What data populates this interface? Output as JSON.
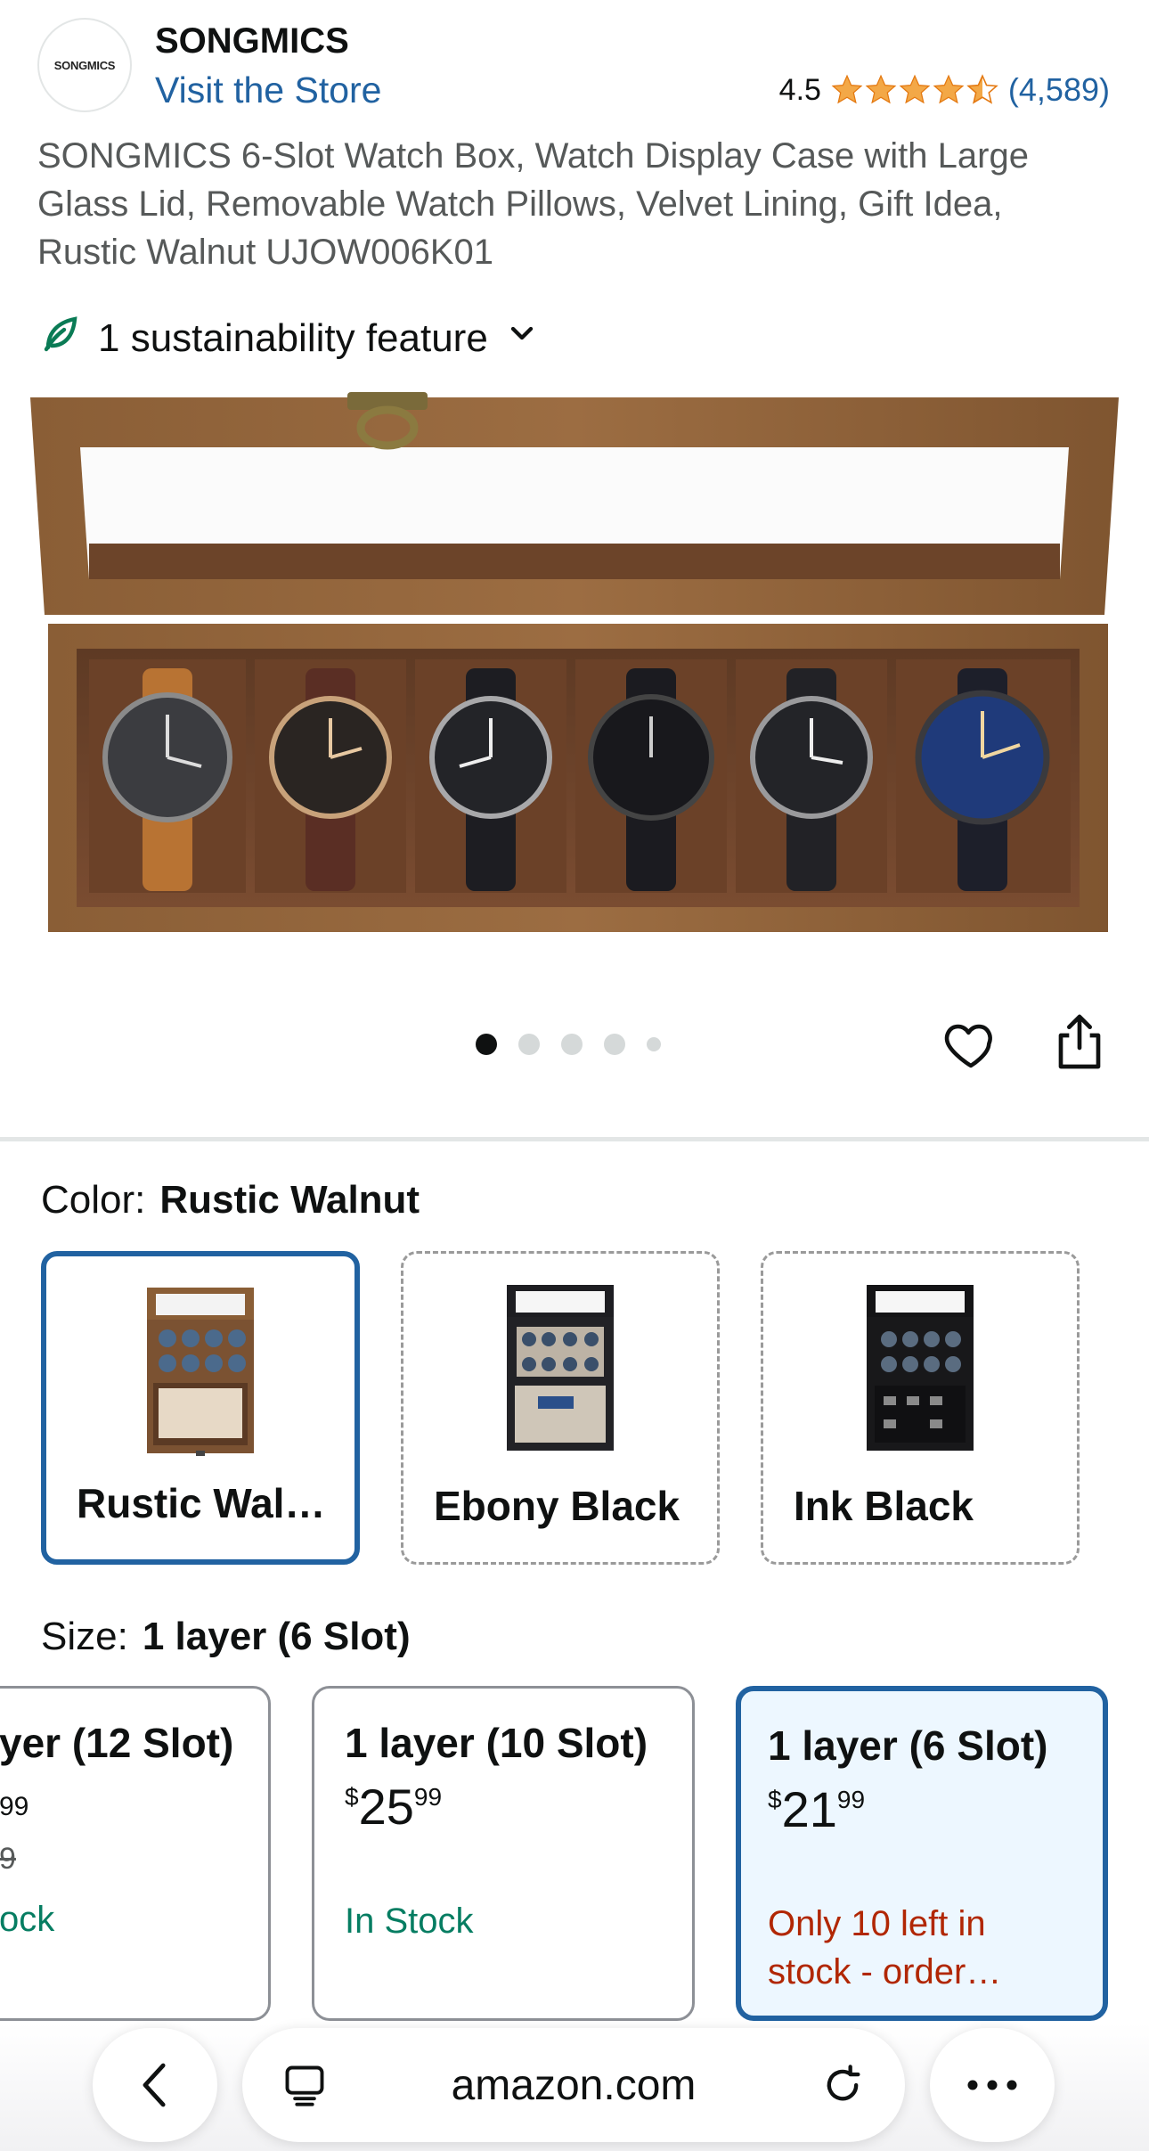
{
  "header": {
    "logo_text": "SONGMICS",
    "brand_name": "SONGMICS",
    "visit_store": "Visit the Store",
    "rating_value": "4.5",
    "rating_stars": 4.5,
    "rating_count": "(4,589)"
  },
  "product": {
    "title": "SONGMICS 6-Slot Watch Box, Watch Display Case with Large Glass Lid, Removable Watch Pillows, Velvet Lining, Gift Idea, Rustic Walnut UJOW006K01",
    "sustainability": "1 sustainability feature",
    "image_count": 5,
    "active_image": 1
  },
  "color": {
    "label": "Color:",
    "selected": "Rustic Walnut",
    "options": [
      {
        "name": "Rustic Wal…",
        "selected": true
      },
      {
        "name": "Ebony Black",
        "selected": false
      },
      {
        "name": "Ink Black",
        "selected": false
      }
    ]
  },
  "size": {
    "label": "Size:",
    "selected": "1 layer (6 Slot)",
    "options": [
      {
        "title": "yer (12 Slot)",
        "price_partial": "99",
        "strike_partial": "9",
        "stock": "ock",
        "selected": false
      },
      {
        "title": "1 layer (10 Slot)",
        "currency": "$",
        "price_whole": "25",
        "price_fraction": "99",
        "stock": "In Stock",
        "selected": false
      },
      {
        "title": "1 layer (6 Slot)",
        "currency": "$",
        "price_whole": "21",
        "price_fraction": "99",
        "stock": "Only 10 left in stock - order…",
        "selected": true
      }
    ]
  },
  "browser": {
    "url": "amazon.com"
  },
  "colors": {
    "link": "#2162a1",
    "star": "#f3a847",
    "in_stock": "#067d62",
    "low_stock": "#b12704",
    "selected_border": "#2162a1"
  }
}
